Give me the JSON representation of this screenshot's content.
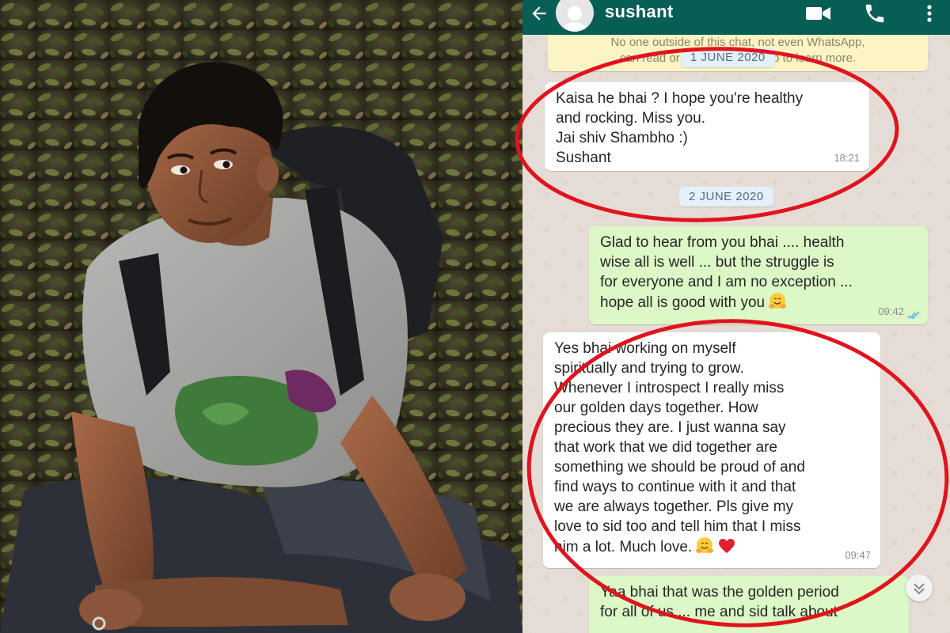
{
  "chat": {
    "contact_name": "sushant",
    "encryption_note_line1": "No one outside of this chat, not even WhatsApp,",
    "encryption_note_line2": "can read or listen to them. Tap to learn more.",
    "messages": [
      {
        "date": "1 JUNE 2020"
      },
      {
        "direction": "incoming",
        "lines": [
          "Kaisa he bhai ? I hope you're healthy",
          "and rocking. Miss you.",
          "Jai shiv Shambho :)",
          "Sushant"
        ],
        "time": "18:21"
      },
      {
        "date": "2 JUNE 2020"
      },
      {
        "direction": "outgoing",
        "lines": [
          "Glad to hear from you bhai .... health",
          "wise all is well ... but the struggle is",
          "for everyone and I am no exception ...",
          "hope all is good with you"
        ],
        "emoji": [
          "hugging-face"
        ],
        "time": "09:42",
        "status": "read"
      },
      {
        "direction": "incoming",
        "lines": [
          "Yes bhai working on myself",
          "spiritually and trying to grow.",
          "Whenever I introspect I really miss",
          "our golden days together. How",
          "precious they are.  I just wanna say",
          "that work that we did together are",
          "something we should be proud of and",
          "find ways to continue with it and that",
          "we are always together. Pls give my",
          "love to sid too and tell him that I miss",
          "him a lot. Much love."
        ],
        "emoji": [
          "hugging-face",
          "red-heart"
        ],
        "time": "09:47"
      },
      {
        "direction": "outgoing",
        "lines": [
          "Yaa bhai that was the golden period",
          "for all of us ... me and sid talk about"
        ]
      }
    ]
  },
  "icons": {
    "back": "back-arrow-icon",
    "avatar": "default-avatar-icon",
    "video": "video-call-icon",
    "call": "phone-icon",
    "menu": "more-vert-icon",
    "scroll": "chevron-down-icon"
  },
  "colors": {
    "header": "#075e54",
    "chat_background": "#e5ddd5",
    "incoming_bubble": "#ffffff",
    "outgoing_bubble": "#dcf8c6",
    "annotation": "#e0141e",
    "read_ticks": "#4fb6ec"
  }
}
